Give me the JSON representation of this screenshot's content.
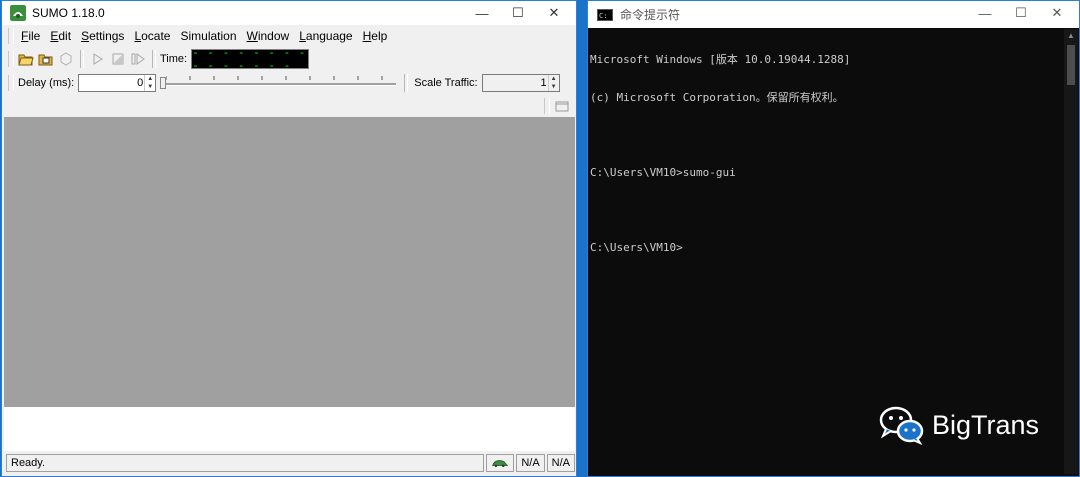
{
  "sumo": {
    "title": "SUMO 1.18.0",
    "window_controls": {
      "minimize": "—",
      "maximize": "☐",
      "close": "✕"
    },
    "menu": [
      {
        "key": "F",
        "rest": "ile"
      },
      {
        "key": "E",
        "rest": "dit"
      },
      {
        "key": "S",
        "rest": "ettings"
      },
      {
        "key": "L",
        "rest": "ocate"
      },
      {
        "key": "",
        "rest": "Simulation"
      },
      {
        "key": "W",
        "rest": "indow"
      },
      {
        "key": "L",
        "rest": "anguage"
      },
      {
        "key": "H",
        "rest": "elp"
      }
    ],
    "time_label": "Time:",
    "time_value": "- - - - - - - - - - - - - - -",
    "delay_label": "Delay (ms):",
    "delay_value": "0",
    "scale_label": "Scale Traffic:",
    "scale_value": "1",
    "status": "Ready.",
    "status_na1": "N/A",
    "status_na2": "N/A"
  },
  "cmd": {
    "title": "命令提示符",
    "window_controls": {
      "minimize": "—",
      "maximize": "☐",
      "close": "✕"
    },
    "lines": [
      "Microsoft Windows [版本 10.0.19044.1288]",
      "(c) Microsoft Corporation。保留所有权利。",
      "",
      "C:\\Users\\VM10>sumo-gui",
      "",
      "C:\\Users\\VM10>"
    ]
  },
  "watermark": {
    "text": "BigTrans"
  },
  "colors": {
    "desktop": "#1a72c9",
    "canvas": "#a0a0a0",
    "cmd_bg": "#0c0c0c",
    "time_digits": "#00ff00"
  }
}
